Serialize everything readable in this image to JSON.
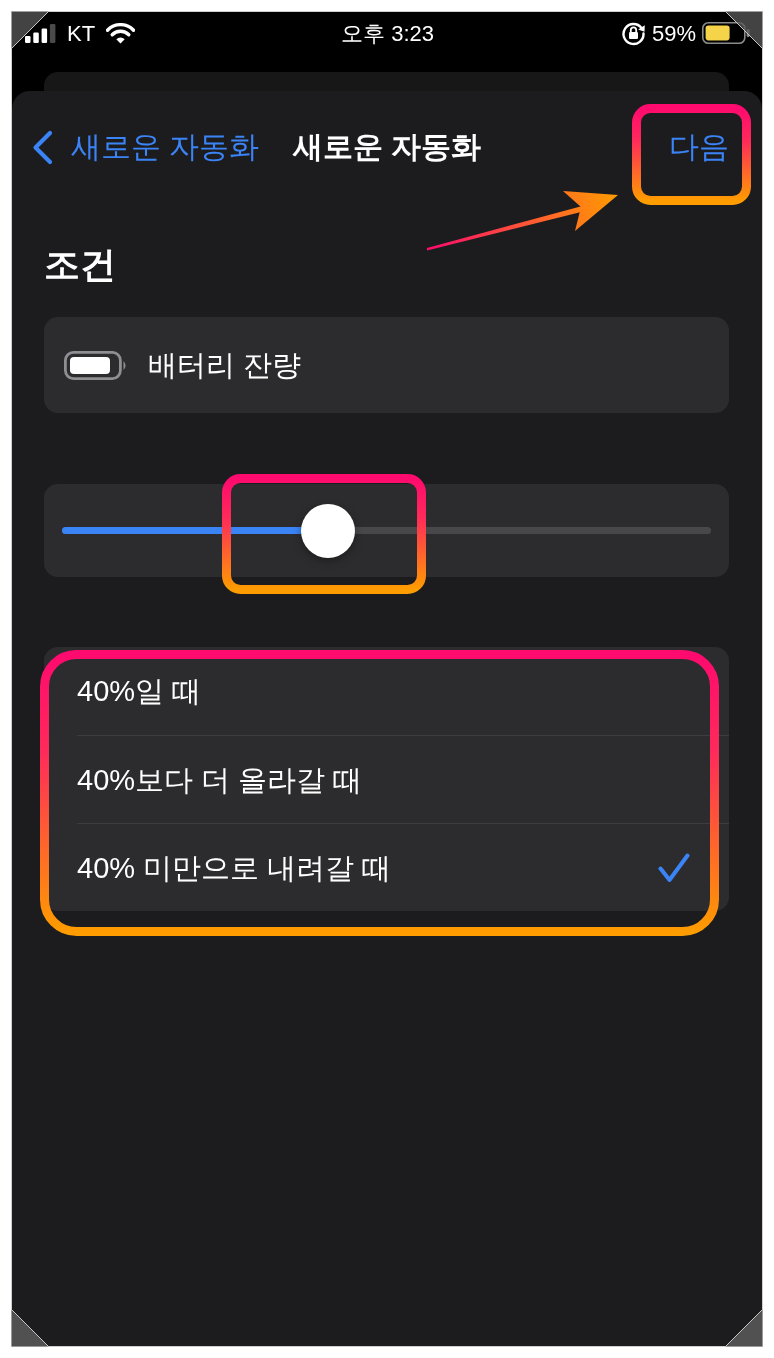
{
  "status_bar": {
    "carrier": "KT",
    "time": "오후 3:23",
    "battery_percent": "59%"
  },
  "nav_bar": {
    "back_label": "새로운 자동화",
    "title": "새로운 자동화",
    "action_label": "다음"
  },
  "section_title": "조건",
  "condition": {
    "label": "배터리 잔량"
  },
  "slider": {
    "level": 0.41
  },
  "options": [
    {
      "label": "40%일 때",
      "selected": false
    },
    {
      "label": "40%보다 더 올라갈 때",
      "selected": false
    },
    {
      "label": "40% 미만으로 내려갈 때",
      "selected": true
    }
  ]
}
